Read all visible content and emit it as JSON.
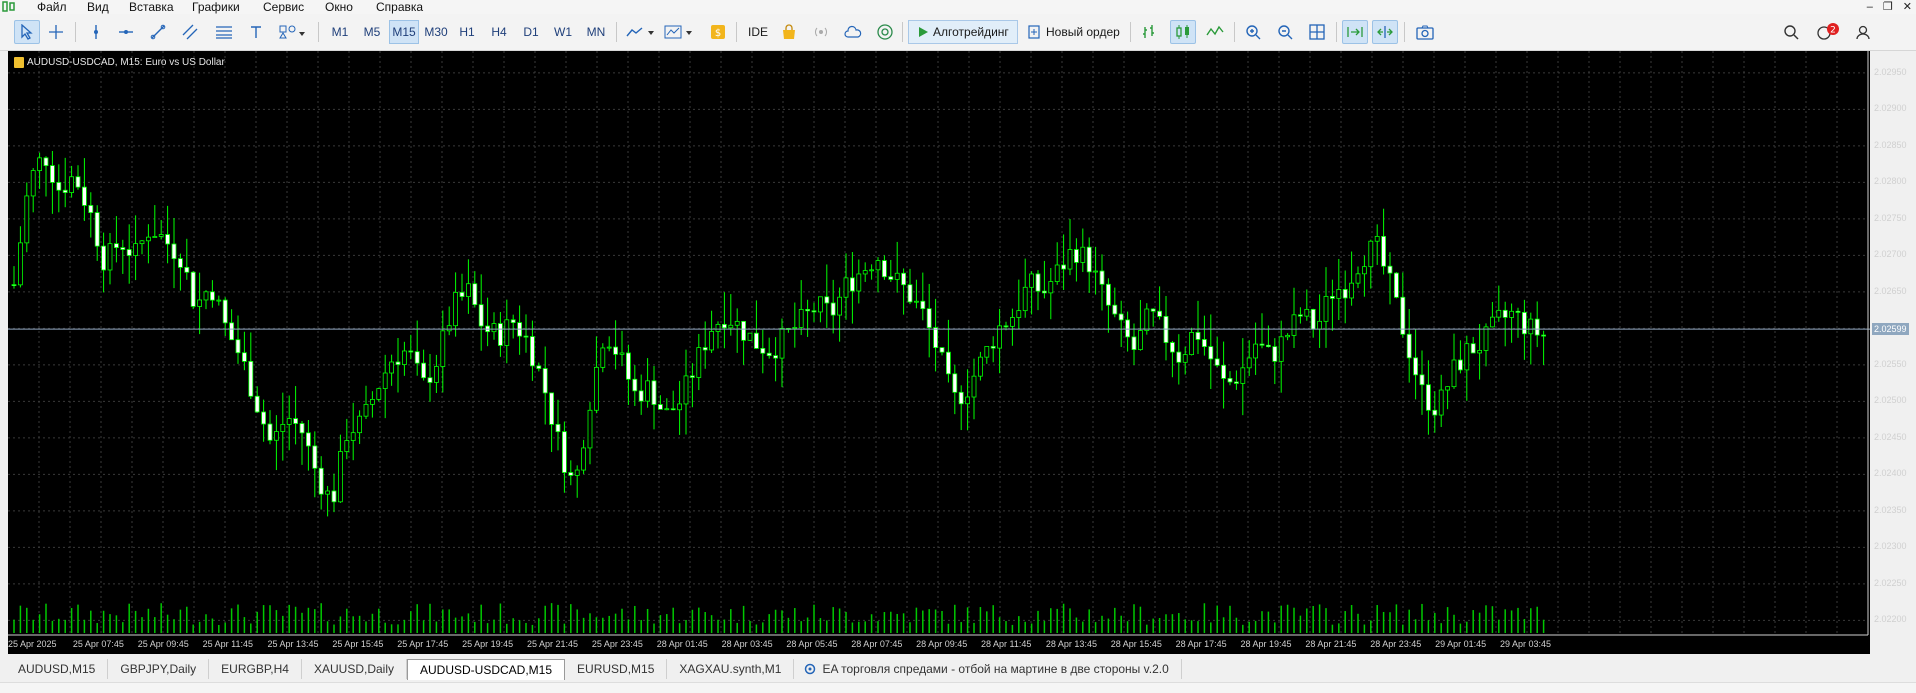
{
  "menu": {
    "items": [
      "Файл",
      "Вид",
      "Вставка",
      "Графики",
      "Сервис",
      "Окно",
      "Справка"
    ]
  },
  "toolbar": {
    "timeframes": [
      "M1",
      "M5",
      "M15",
      "M30",
      "H1",
      "H4",
      "D1",
      "W1",
      "MN"
    ],
    "active_timeframe": "M15",
    "ide_label": "IDE",
    "algo_label": "Алготрейдинг",
    "new_order_label": "Новый ордер",
    "notifications_count": "2"
  },
  "chart": {
    "title": "AUDUSD-USDCAD, M15:  Euro vs US Dollar",
    "current_price": "2.02599",
    "background": "#000000",
    "candle_color": "#00ff00",
    "grid_color": "#3a3a3a"
  },
  "chart_data": {
    "type": "candlestick",
    "title": "AUDUSD-USDCAD, M15:  Euro vs US Dollar",
    "y_range": [
      2.0218,
      2.0298
    ],
    "price_ticks": [
      "2.02950",
      "2.02900",
      "2.02850",
      "2.02800",
      "2.02750",
      "2.02700",
      "2.02650",
      "2.02550",
      "2.02500",
      "2.02450",
      "2.02400",
      "2.02350",
      "2.02300",
      "2.02250",
      "2.02200"
    ],
    "time_ticks": [
      "25 Apr 2025",
      "25 Apr 07:45",
      "25 Apr 09:45",
      "25 Apr 11:45",
      "25 Apr 13:45",
      "25 Apr 15:45",
      "25 Apr 17:45",
      "25 Apr 19:45",
      "25 Apr 21:45",
      "25 Apr 23:45",
      "28 Apr 01:45",
      "28 Apr 03:45",
      "28 Apr 05:45",
      "28 Apr 07:45",
      "28 Apr 09:45",
      "28 Apr 11:45",
      "28 Apr 13:45",
      "28 Apr 15:45",
      "28 Apr 17:45",
      "28 Apr 19:45",
      "28 Apr 21:45",
      "28 Apr 23:45",
      "29 Apr 01:45",
      "29 Apr 03:45"
    ],
    "close_path": [
      2.0266,
      2.028,
      2.0284,
      2.0279,
      2.0281,
      2.0276,
      2.0269,
      2.0272,
      2.027,
      2.0274,
      2.0272,
      2.027,
      2.0263,
      2.0266,
      2.026,
      2.0256,
      2.025,
      2.0244,
      2.0248,
      2.0246,
      2.024,
      2.0236,
      2.0246,
      2.0247,
      2.0252,
      2.0256,
      2.0257,
      2.0252,
      2.0256,
      2.0263,
      2.0265,
      2.026,
      2.0259,
      2.0261,
      2.0258,
      2.0252,
      2.0244,
      2.0238,
      2.025,
      2.026,
      2.0256,
      2.0251,
      2.0252,
      2.0248,
      2.025,
      2.0255,
      2.026,
      2.0262,
      2.026,
      2.0258,
      2.0257,
      2.0259,
      2.0261,
      2.0263,
      2.0262,
      2.0266,
      2.0268,
      2.027,
      2.0267,
      2.0265,
      2.0262,
      2.0257,
      2.025,
      2.0252,
      2.0256,
      2.026,
      2.0262,
      2.0266,
      2.0265,
      2.0268,
      2.0271,
      2.0269,
      2.0264,
      2.026,
      2.0257,
      2.0262,
      2.0259,
      2.0256,
      2.026,
      2.0256,
      2.0252,
      2.0254,
      2.0258,
      2.0256,
      2.0259,
      2.0262,
      2.026,
      2.0265,
      2.0266,
      2.027,
      2.0271,
      2.0265,
      2.0258,
      2.0251,
      2.0249,
      2.0254,
      2.0257,
      2.0258,
      2.0261,
      2.0262,
      2.026,
      2.0259
    ],
    "volume_scale": "relative tick volume"
  },
  "tabs": {
    "items": [
      "AUDUSD,M15",
      "GBPJPY,Daily",
      "EURGBP,H4",
      "XAUUSD,Daily",
      "AUDUSD-USDCAD,M15",
      "EURUSD,M15",
      "XAGXAU.synth,M1"
    ],
    "active_index": 4,
    "ea_label": "EA торговля спредами - отбой на мартине в две стороны v.2.0"
  }
}
